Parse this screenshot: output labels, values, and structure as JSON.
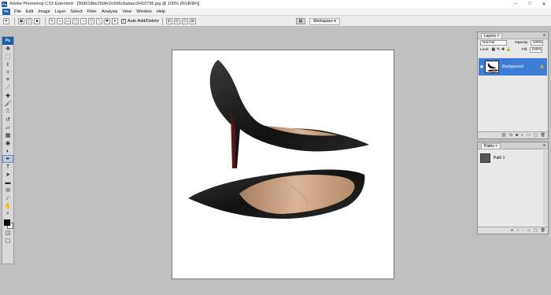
{
  "window": {
    "app_icon": "Ps",
    "title": "Adobe Photoshop CS3 Extended - [30d018be29d4c0c996c6abacc6410795.jpg @ 100% (RGB/8#)]",
    "controls": [
      "–",
      "□",
      "✕"
    ]
  },
  "menu": {
    "badge": "Ps",
    "items": [
      "File",
      "Edit",
      "Image",
      "Layer",
      "Select",
      "Filter",
      "Analysis",
      "View",
      "Window",
      "Help"
    ]
  },
  "options": {
    "auto_add_delete": "Auto Add/Delete",
    "auto_add_checked": true
  },
  "workspace": {
    "label": "Workspace ▾"
  },
  "toolbox": {
    "logo": "Ps",
    "tools": [
      "move-tool",
      "marquee-tool",
      "lasso-tool",
      "magic-wand-tool",
      "crop-tool",
      "slice-tool",
      "healing-tool",
      "brush-tool",
      "stamp-tool",
      "history-brush-tool",
      "eraser-tool",
      "gradient-tool",
      "blur-tool",
      "dodge-tool",
      "pen-tool",
      "type-tool",
      "path-select-tool",
      "shape-tool",
      "notes-tool",
      "eyedropper-tool",
      "hand-tool",
      "zoom-tool"
    ],
    "active_tool": "pen-tool",
    "foreground": "#000000",
    "background": "#ffffff"
  },
  "layers_panel": {
    "tab": "Layers ×",
    "blend_mode": "Normal",
    "opacity_label": "Opacity:",
    "opacity_value": "100%",
    "lock_label": "Lock:",
    "fill_label": "Fill:",
    "fill_value": "100%",
    "layer_name": "Background",
    "selected_color": "#3d7dd6"
  },
  "paths_panel": {
    "tab": "Paths ×",
    "path_name": "Path 1"
  }
}
